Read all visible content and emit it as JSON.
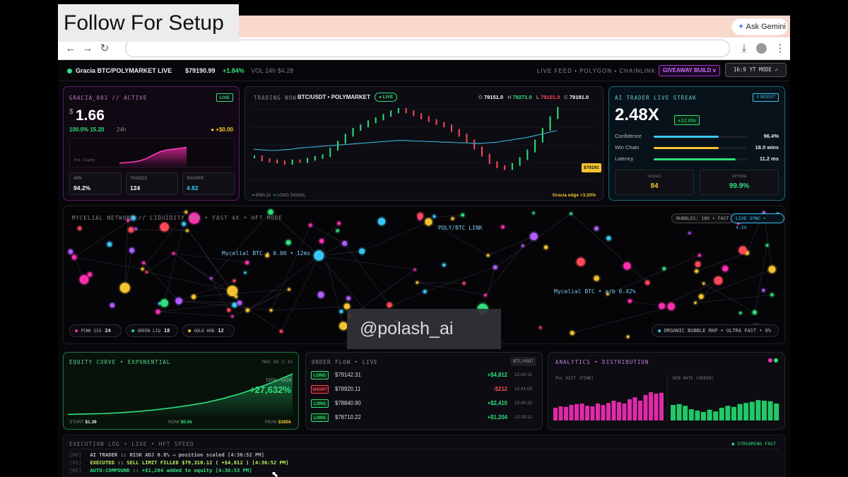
{
  "overlay": {
    "caption": "Follow For Setup",
    "watermark": "@polash_ai"
  },
  "browser": {
    "ask_gemini": "Ask Gemini"
  },
  "header": {
    "status_name": "Gracia BTC/POLYMARKET LIVE",
    "price": "$79190.99",
    "change": "+1.84%",
    "volume": "VOL 24h $4.28",
    "feed": "LIVE FEED • POLYGON • CHAINLINK",
    "giveaway": "GIVEAWAY BUILD v",
    "mode_button": "16:9 YT MODE ✓"
  },
  "account": {
    "title": "GRACIA_001 // ACTIVE",
    "badge": "LIVE",
    "currency": "$",
    "value": "1.66",
    "pct": "100.0% 15.20",
    "period": "24h",
    "pnl_change": "+$0.00",
    "chart_label": "PnL / Equity",
    "stats": [
      {
        "label": "WIN",
        "value": "94.2%",
        "color": "#ffffff"
      },
      {
        "label": "TRADES",
        "value": "124",
        "color": "#ffffff"
      },
      {
        "label": "SHARPE",
        "value": "4.82",
        "color": "#38c8f0"
      }
    ],
    "equity_curve": [
      0.1,
      0.12,
      0.15,
      0.2,
      0.3,
      0.45,
      0.6,
      0.68,
      0.72,
      0.75,
      0.8
    ]
  },
  "trading": {
    "title": "TRADING NOW",
    "pair": "BTC/USDT • POLYMARKET",
    "badge": "LIVE",
    "ohlc": [
      {
        "k": "O",
        "v": "79151.0",
        "color": "#ffffff"
      },
      {
        "k": "H",
        "v": "79271.0",
        "color": "#33e07a"
      },
      {
        "k": "L",
        "v": "79101.0",
        "color": "#ff4a5a"
      },
      {
        "k": "C",
        "v": "79191.0",
        "color": "#ffffff"
      }
    ],
    "price_tag": "$79191",
    "legend_ema": "EMA 21",
    "legend_signal": "LONG SIGNAL",
    "edge": "Gracia edge +3.20%",
    "closes": [
      79185,
      79180,
      79178,
      79176,
      79174,
      79178,
      79177,
      79181,
      79184,
      79187,
      79198,
      79210,
      79222,
      79232,
      79238,
      79245,
      79250,
      79256,
      79262,
      79266,
      79262,
      79257,
      79252,
      79247,
      79242,
      79238,
      79230,
      79222,
      79212,
      79200,
      79188,
      79175,
      79168,
      79165,
      79172,
      79182,
      79195,
      79212,
      79232,
      79252,
      79268
    ],
    "ema": [
      79198,
      79197,
      79196,
      79196,
      79197,
      79198,
      79200,
      79201,
      79202,
      79203,
      79204,
      79205,
      79206,
      79207,
      79208,
      79209,
      79210,
      79211,
      79212,
      79213,
      79213,
      79212,
      79212,
      79211,
      79211,
      79210,
      79210,
      79209,
      79209,
      79208,
      79208,
      79209,
      79210,
      79212,
      79214,
      79216,
      79218,
      79221,
      79224,
      79227,
      79230
    ]
  },
  "streak": {
    "title": "AI TRADER LIVE STREAK",
    "badge": "X BOOST",
    "value": "2.48X",
    "change": "+12.0%",
    "bars": [
      {
        "label": "Confidence",
        "value": "96.4%",
        "fraction": 0.7,
        "color": "#39c6f2"
      },
      {
        "label": "Win Chain",
        "value": "18.0 wins",
        "fraction": 0.7,
        "color": "#f4c430"
      },
      {
        "label": "Latency",
        "value": "11.2 ms",
        "fraction": 0.88,
        "color": "#2fe07c"
      }
    ],
    "nodes_label": "NODES",
    "nodes_value": "84",
    "uptime_label": "UPTIME",
    "uptime_value": "99.9%"
  },
  "network": {
    "title": "MYCELIAL NETWORK // LIQUIDITY MAP • FAST 4X • HFT MODE",
    "bubbles_chip": "BUBBLES: 180 • FAST",
    "sync_chip": "LIVE SYNC • 4.5X",
    "label_link": "POLY/BTC LINK",
    "label_btc": "Mycelial BTC • 0.00 • 12ms",
    "label_arb": "Mycelial BTC • arb 0.42%",
    "legend": [
      {
        "label": "PINK SIG",
        "count": "24",
        "color": "#ff2fb0"
      },
      {
        "label": "GREEN LIQ",
        "count": "18",
        "color": "#2fe07c"
      },
      {
        "label": "GOLD ARB",
        "count": "12",
        "color": "#f4c430"
      }
    ],
    "footer": "ORGANIC BUBBLE MAP • ULTRA FAST • 0%"
  },
  "equity": {
    "title": "EQUITY CURVE • EXPONENTIAL",
    "max_dd": "MAX DD 2.1%",
    "total_label": "TOTAL GAIN",
    "total_value": "+27,632%",
    "start_label": "START",
    "start_value": "$1.39",
    "now_label": "NOW",
    "now_value": "$0.0k",
    "peak_label": "PEAK",
    "peak_value": "$385k",
    "curve": [
      0.01,
      0.02,
      0.03,
      0.05,
      0.08,
      0.12,
      0.17,
      0.23,
      0.3,
      0.4,
      0.52,
      0.66,
      0.82,
      1.0
    ]
  },
  "orders": {
    "title": "ORDER FLOW • LIVE",
    "pair": "BTC/USDT",
    "rows": [
      {
        "side": "LONG",
        "price": "$79142.31",
        "pnl": "+$4,812",
        "time": "12:42:11",
        "color": "#2fe07c"
      },
      {
        "side": "SHORT",
        "price": "$78920.11",
        "pnl": "-$212",
        "time": "12:41:03",
        "color": "#ff4a5a"
      },
      {
        "side": "LONG",
        "price": "$78840.90",
        "pnl": "+$2,410",
        "time": "12:40:22",
        "color": "#2fe07c"
      },
      {
        "side": "LONG",
        "price": "$78710.22",
        "pnl": "+$1,204",
        "time": "12:39:11",
        "color": "#2fe07c"
      }
    ]
  },
  "analytics": {
    "title": "ANALYTICS • DISTRIBUTION",
    "pnl_hist_label": "PnL HIST (PINK)",
    "winrate_label": "WIN RATE (GREEN)",
    "pink_bars": [
      0.45,
      0.5,
      0.48,
      0.55,
      0.58,
      0.6,
      0.52,
      0.5,
      0.6,
      0.55,
      0.62,
      0.7,
      0.65,
      0.6,
      0.75,
      0.82,
      0.7,
      0.9,
      1.0,
      0.95,
      0.98
    ],
    "green_bars": [
      0.55,
      0.58,
      0.52,
      0.4,
      0.35,
      0.3,
      0.38,
      0.32,
      0.45,
      0.52,
      0.48,
      0.58,
      0.62,
      0.66,
      0.72,
      0.7,
      0.68,
      0.6
    ]
  },
  "log": {
    "title": "EXECUTION LOG • LIVE • HFT SPEED",
    "streaming": "STREAMING FAST",
    "lines": [
      {
        "id": "[00]",
        "text": "AI TRADER :: RISK ADJ 0.8% → position scaled [4:36:52 PM]",
        "color": "#b9b9c4"
      },
      {
        "id": "[01]",
        "text": "EXECUTED :: SELL LIMIT FILLED $79,310.12 ( +$4,812 ) [4:36:52 PM]",
        "color": "#c6f25a"
      },
      {
        "id": "[02]",
        "text": "AUTO-COMPOUND :: +$1,204 added to equity [4:36:53 PM]",
        "color": "#2fe07c"
      }
    ]
  }
}
